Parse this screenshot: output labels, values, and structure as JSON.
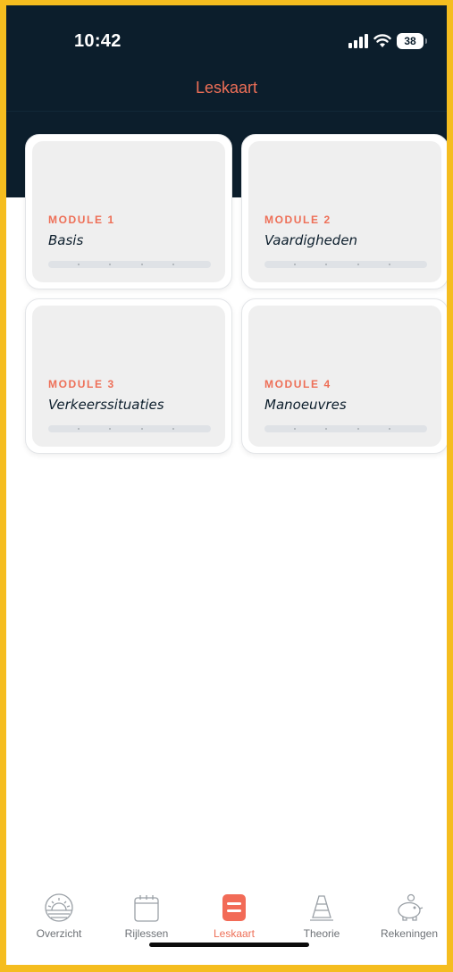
{
  "status_bar": {
    "time": "10:42",
    "battery": "38"
  },
  "header": {
    "title": "Leskaart"
  },
  "modules": [
    {
      "label": "MODULE 1",
      "title": "Basis"
    },
    {
      "label": "MODULE 2",
      "title": "Vaardigheden"
    },
    {
      "label": "MODULE 3",
      "title": "Verkeerssituaties"
    },
    {
      "label": "MODULE 4",
      "title": "Manoeuvres"
    }
  ],
  "tabbar": {
    "items": [
      {
        "label": "Overzicht",
        "icon": "sun-horizon-icon"
      },
      {
        "label": "Rijlessen",
        "icon": "calendar-icon"
      },
      {
        "label": "Leskaart",
        "icon": "lesson-card-icon",
        "active": true
      },
      {
        "label": "Theorie",
        "icon": "traffic-cone-icon"
      },
      {
        "label": "Rekeningen",
        "icon": "piggy-bank-icon"
      }
    ]
  },
  "colors": {
    "header_bg": "#0c1e2c",
    "accent": "#ee6f57",
    "card_bg": "#efefef",
    "frame_border": "#f5bd1f"
  }
}
